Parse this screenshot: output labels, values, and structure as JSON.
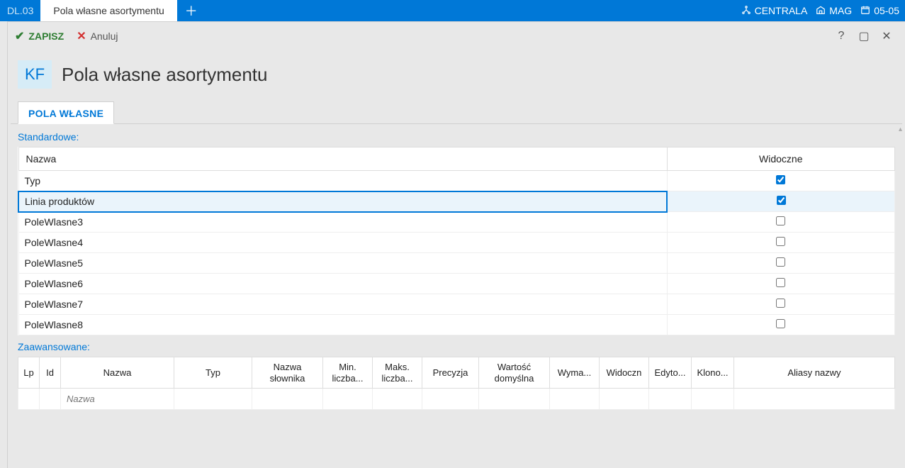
{
  "titlebar": {
    "prev_tab": "DL.03",
    "active_tab": "Pola własne asortymentu",
    "right": {
      "centrala": "CENTRALA",
      "mag": "MAG",
      "date": "05-05"
    }
  },
  "actions": {
    "save": "ZAPISZ",
    "cancel": "Anuluj"
  },
  "header": {
    "badge": "KF",
    "title": "Pola własne asortymentu"
  },
  "tabs": {
    "own_fields": "POLA WŁASNE"
  },
  "sections": {
    "standard": "Standardowe:",
    "advanced": "Zaawansowane:"
  },
  "standard_table": {
    "col_name": "Nazwa",
    "col_visible": "Widoczne",
    "rows": [
      {
        "name": "Typ",
        "visible": true,
        "selected": false
      },
      {
        "name": "Linia produktów",
        "visible": true,
        "selected": true
      },
      {
        "name": "PoleWlasne3",
        "visible": false,
        "selected": false
      },
      {
        "name": "PoleWlasne4",
        "visible": false,
        "selected": false
      },
      {
        "name": "PoleWlasne5",
        "visible": false,
        "selected": false
      },
      {
        "name": "PoleWlasne6",
        "visible": false,
        "selected": false
      },
      {
        "name": "PoleWlasne7",
        "visible": false,
        "selected": false
      },
      {
        "name": "PoleWlasne8",
        "visible": false,
        "selected": false
      }
    ]
  },
  "advanced_table": {
    "headers": {
      "lp": "Lp",
      "id": "Id",
      "name": "Nazwa",
      "type": "Typ",
      "dict": "Nazwa słownika",
      "min": "Min. liczba...",
      "max": "Maks. liczba...",
      "prec": "Precyzja",
      "def": "Wartość domyślna",
      "req": "Wyma...",
      "vis": "Widoczn",
      "edit": "Edyto...",
      "clone": "Klono...",
      "alias": "Aliasy nazwy"
    },
    "new_row_placeholder": "Nazwa"
  }
}
